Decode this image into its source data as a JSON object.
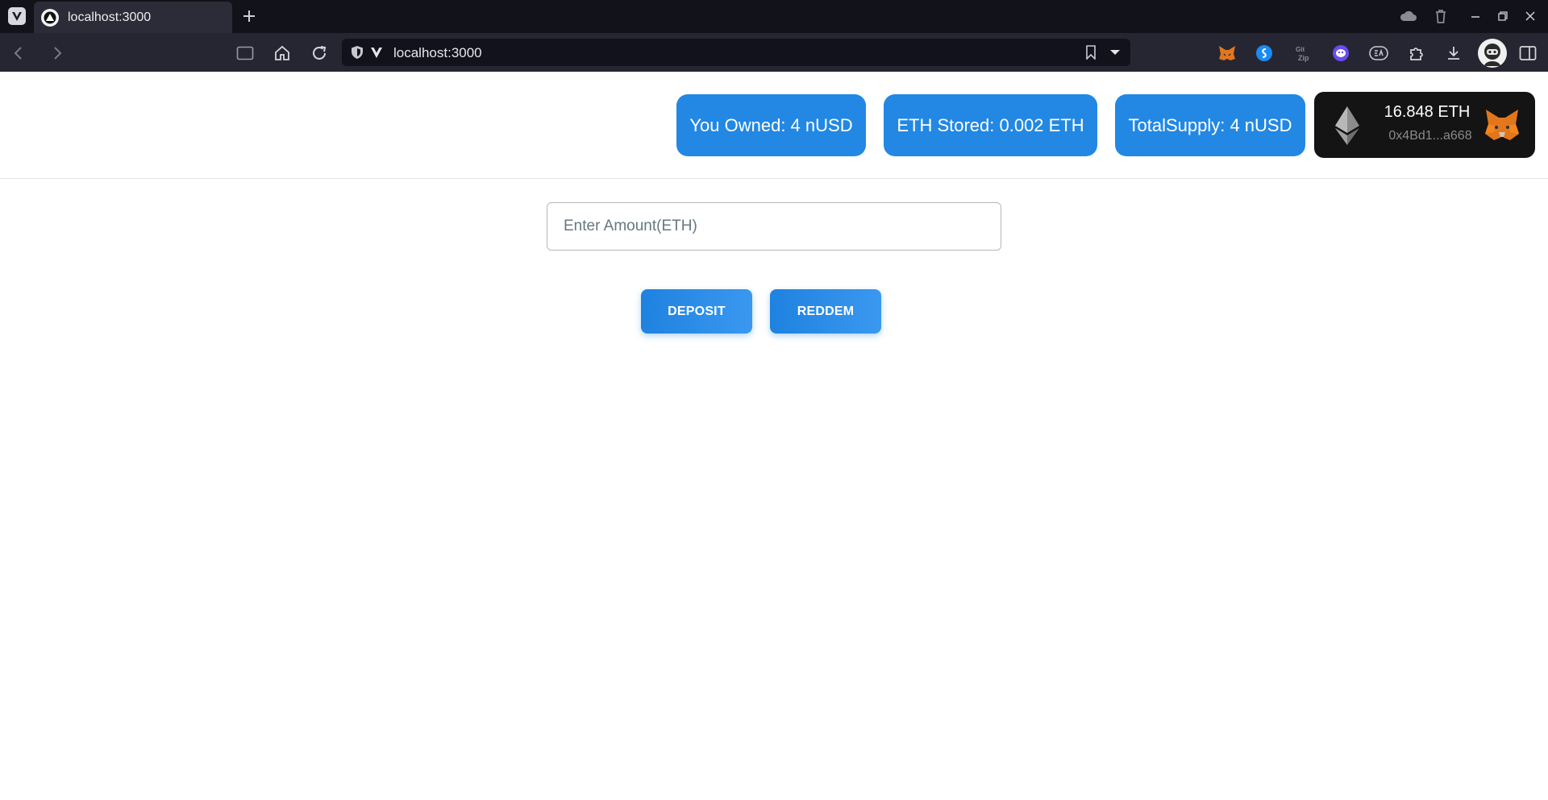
{
  "browser": {
    "tab_title": "localhost:3000",
    "url": "localhost:3000",
    "icons": [
      "vivaldi-menu-icon",
      "tab-favicon-icon",
      "new-tab-icon",
      "sync-cloud-icon",
      "trash-icon",
      "minimize-icon",
      "restore-icon",
      "close-icon",
      "back-icon",
      "forward-icon",
      "panel-toggle-icon",
      "home-icon",
      "reload-icon",
      "shield-icon",
      "vivaldi-v-icon",
      "bookmark-icon",
      "dropdown-icon",
      "metamask-extension-icon",
      "shazam-extension-icon",
      "gitzip-extension-icon",
      "ghost-extension-icon",
      "ea-extension-icon",
      "extensions-puzzle-icon",
      "download-icon",
      "profile-avatar-icon",
      "sidebar-toggle-icon"
    ],
    "colors": {
      "tabbar": "#12121a",
      "navbar": "#262633",
      "urlbar": "#12121c"
    }
  },
  "header": {
    "stats": [
      {
        "label": "You Owned: 4 nUSD"
      },
      {
        "label": "ETH Stored: 0.002 ETH"
      },
      {
        "label": "TotalSupply: 4 nUSD"
      }
    ],
    "wallet": {
      "balance": "16.848 ETH",
      "address": "0x4Bd1...a668",
      "icons": [
        "ethereum-icon",
        "metamask-fox-icon"
      ]
    },
    "colors": {
      "stat_bg": "#2288e3",
      "wallet_bg": "#141414"
    }
  },
  "form": {
    "amount_placeholder": "Enter Amount(ETH)",
    "amount_value": "",
    "deposit_label": "DEPOSIT",
    "redeem_label": "REDDEM",
    "colors": {
      "button": "#2288e3"
    }
  }
}
